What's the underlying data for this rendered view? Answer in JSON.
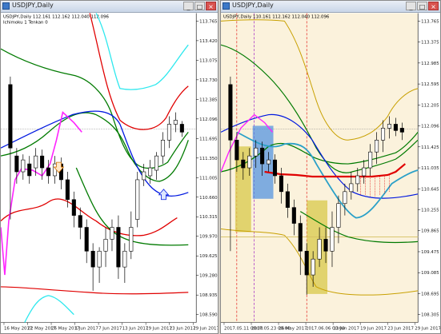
{
  "left_window": {
    "title": "USDJPY,Daily",
    "symbol_line": "USDJPY,Daily 112.161 112.162 112.040 112.096",
    "indicator_line": "Ichimoku 1 Tenkan 0",
    "y_ticks": [
      "113.765",
      "113.420",
      "113.075",
      "112.730",
      "112.385",
      "112.096",
      "111.695",
      "111.350",
      "111.005",
      "110.660",
      "110.315",
      "109.970",
      "109.625",
      "109.280",
      "108.935",
      "108.590"
    ],
    "x_ticks": [
      "16 May 2017",
      "22 May 2017",
      "26 May 2017",
      "1 Jun 2017",
      "7 Jun 2017",
      "13 Jun 2017",
      "19 Jun 2017",
      "23 Jun 2017",
      "29 Jun 2017"
    ],
    "buttons": [
      "_",
      "□",
      "×"
    ]
  },
  "right_window": {
    "title": "USDJPY,Daily",
    "symbol_line": "USDJPY,Daily 110.161 112.162 112.040 112.096",
    "y_ticks": [
      "113.765",
      "113.375",
      "112.985",
      "112.595",
      "112.205",
      "112.096",
      "111.425",
      "111.035",
      "110.645",
      "110.255",
      "109.865",
      "109.475",
      "109.085",
      "108.695",
      "108.305"
    ],
    "x_ticks": [
      "2017.05.11 00:00",
      "2017.05.23 00:00",
      "26 May 2017",
      "2017.06.06 00:00",
      "13 Jun 2017",
      "19 Jun 2017",
      "23 Jun 2017",
      "29 Jun 2017"
    ],
    "buttons": [
      "_",
      "□",
      "×"
    ]
  },
  "colors": {
    "up": "#000000",
    "down": "#000000",
    "red": "#e00000",
    "green": "#007a00",
    "blue": "#0018e0",
    "cyan": "#2ee8ee",
    "magenta": "#ff22ff",
    "gold": "#c8a000",
    "pale": "#fbf2dc"
  }
}
